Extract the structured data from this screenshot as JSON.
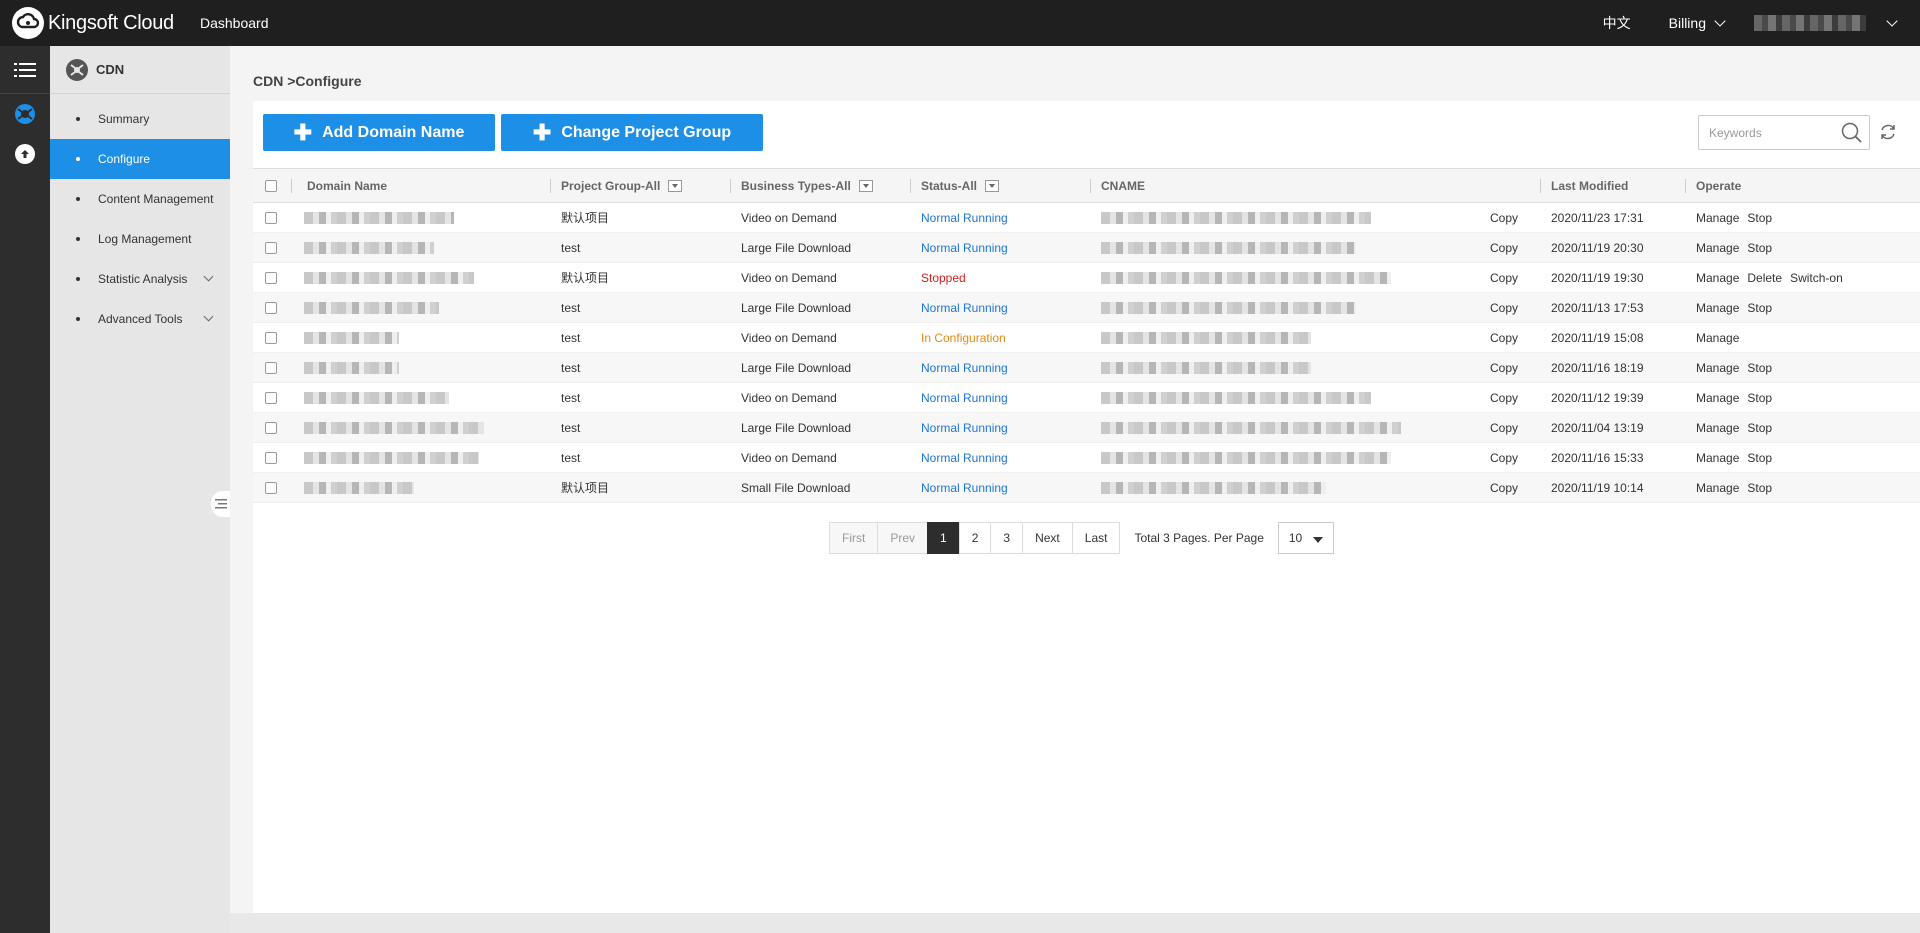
{
  "topbar": {
    "brand": "Kingsoft Cloud",
    "dashboard": "Dashboard",
    "language": "中文",
    "billing": "Billing"
  },
  "sidebar": {
    "title": "CDN",
    "items": [
      {
        "label": "Summary"
      },
      {
        "label": "Configure"
      },
      {
        "label": "Content Management"
      },
      {
        "label": "Log Management"
      },
      {
        "label": "Statistic Analysis"
      },
      {
        "label": "Advanced Tools"
      }
    ]
  },
  "breadcrumb": "CDN >Configure",
  "toolbar": {
    "add_label": "Add Domain Name",
    "change_label": "Change Project Group",
    "search_placeholder": "Keywords"
  },
  "table": {
    "headers": {
      "domain": "Domain Name",
      "project": "Project Group-All",
      "business": "Business Types-All",
      "status": "Status-All",
      "cname": "CNAME",
      "modified": "Last Modified",
      "operate": "Operate"
    },
    "rows": [
      {
        "project": "默认项目",
        "business": "Video on Demand",
        "status": "Normal Running",
        "status_kind": "normal",
        "copy": "Copy",
        "modified": "2020/11/23 17:31",
        "ops": [
          "Manage",
          "Stop"
        ]
      },
      {
        "project": "test",
        "business": "Large File Download",
        "status": "Normal Running",
        "status_kind": "normal",
        "copy": "Copy",
        "modified": "2020/11/19 20:30",
        "ops": [
          "Manage",
          "Stop"
        ]
      },
      {
        "project": "默认项目",
        "business": "Video on Demand",
        "status": "Stopped",
        "status_kind": "stopped",
        "copy": "Copy",
        "modified": "2020/11/19 19:30",
        "ops": [
          "Manage",
          "Delete",
          "Switch-on"
        ]
      },
      {
        "project": "test",
        "business": "Large File Download",
        "status": "Normal Running",
        "status_kind": "normal",
        "copy": "Copy",
        "modified": "2020/11/13 17:53",
        "ops": [
          "Manage",
          "Stop"
        ]
      },
      {
        "project": "test",
        "business": "Video on Demand",
        "status": "In Configuration",
        "status_kind": "config",
        "copy": "Copy",
        "modified": "2020/11/19 15:08",
        "ops": [
          "Manage"
        ]
      },
      {
        "project": "test",
        "business": "Large File Download",
        "status": "Normal Running",
        "status_kind": "normal",
        "copy": "Copy",
        "modified": "2020/11/16 18:19",
        "ops": [
          "Manage",
          "Stop"
        ]
      },
      {
        "project": "test",
        "business": "Video on Demand",
        "status": "Normal Running",
        "status_kind": "normal",
        "copy": "Copy",
        "modified": "2020/11/12 19:39",
        "ops": [
          "Manage",
          "Stop"
        ]
      },
      {
        "project": "test",
        "business": "Large File Download",
        "status": "Normal Running",
        "status_kind": "normal",
        "copy": "Copy",
        "modified": "2020/11/04 13:19",
        "ops": [
          "Manage",
          "Stop"
        ]
      },
      {
        "project": "test",
        "business": "Video on Demand",
        "status": "Normal Running",
        "status_kind": "normal",
        "copy": "Copy",
        "modified": "2020/11/16 15:33",
        "ops": [
          "Manage",
          "Stop"
        ]
      },
      {
        "project": "默认项目",
        "business": "Small File Download",
        "status": "Normal Running",
        "status_kind": "normal",
        "copy": "Copy",
        "modified": "2020/11/19 10:14",
        "ops": [
          "Manage",
          "Stop"
        ]
      }
    ]
  },
  "pagination": {
    "first": "First",
    "prev": "Prev",
    "pages": [
      "1",
      "2",
      "3"
    ],
    "current": "1",
    "next": "Next",
    "last": "Last",
    "info": "Total 3 Pages. Per Page",
    "per_page": "10"
  },
  "colors": {
    "accent": "#1e8fe6",
    "topbar": "#1f1f1f",
    "status_normal": "#1e76d8",
    "status_stopped": "#d02020",
    "status_config": "#e88a10"
  },
  "icons": [
    "kingsoft-cloud-logo-icon",
    "menu-icon",
    "cdn-icon",
    "cloud-upload-icon",
    "plus-icon",
    "search-icon",
    "refresh-icon",
    "chevron-down-icon",
    "collapse-sidebar-icon"
  ]
}
